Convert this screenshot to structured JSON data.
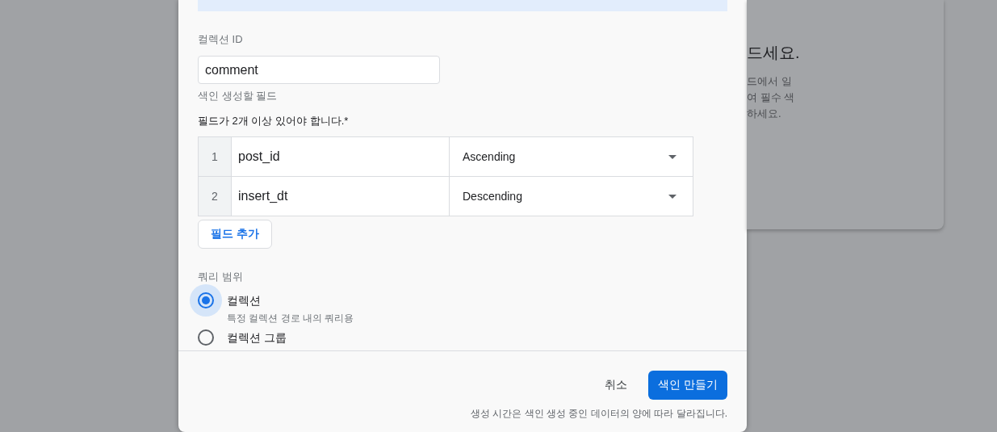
{
  "background_card": {
    "heading": "드세요.",
    "lines": [
      "드에서 일",
      "여 필수 색",
      "하세요."
    ]
  },
  "dialog": {
    "collection_id": {
      "label": "컬렉션 ID",
      "value": "comment"
    },
    "fields_label": "색인 생성할 필드",
    "fields_hint": "필드가 2개 이상 있어야 합니다.*",
    "fields": [
      {
        "number": "1",
        "field": "post_id",
        "order": "Ascending"
      },
      {
        "number": "2",
        "field": "insert_dt",
        "order": "Descending"
      }
    ],
    "add_field_button": "필드 추가",
    "query_scope": {
      "label": "쿼리 범위",
      "options": [
        {
          "label": "컬렉션",
          "description": "특정 컬렉션 경로 내의 쿼리용",
          "selected": true
        },
        {
          "label": "컬렉션 그룹",
          "selected": false
        }
      ]
    },
    "cancel_button": "취소",
    "create_button": "색인 만들기",
    "note": "생성 시간은 색인 생성 중인 데이터의 양에 따라 달라집니다."
  }
}
